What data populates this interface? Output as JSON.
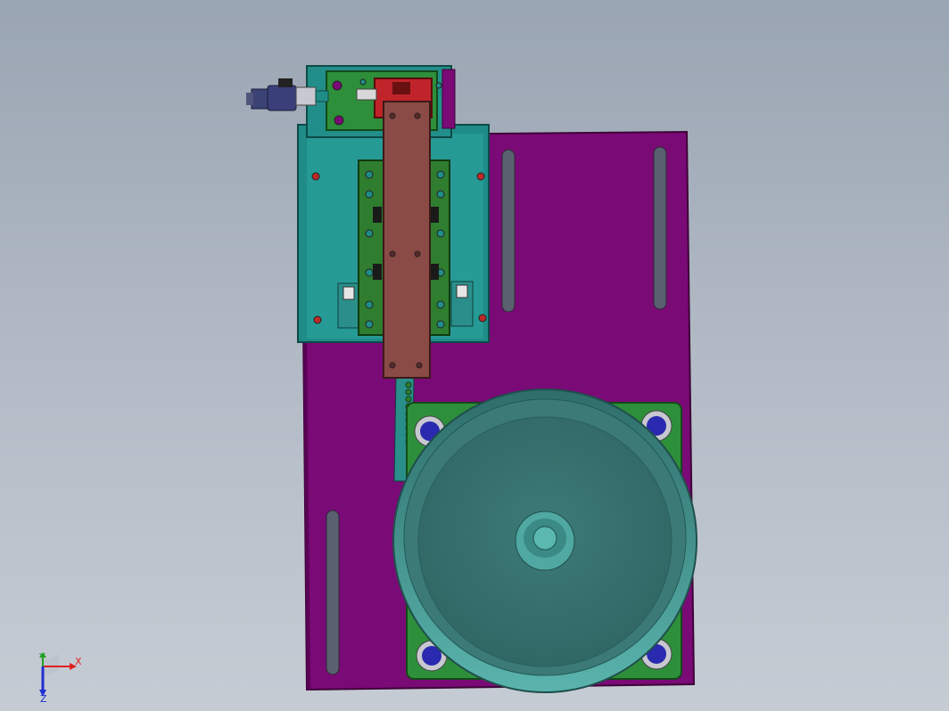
{
  "viewport": {
    "background_top": "#9aa5b3",
    "background_bottom": "#c6ccd4"
  },
  "colors": {
    "base_plate": "#7a0a76",
    "base_plate_edge": "#4e044b",
    "mount_plate": "#1e8a86",
    "rail_block": "#2f7d2f",
    "slider_bar": "#8a4a46",
    "clamp_block": "#c0242a",
    "bowl": "#3f8f8a",
    "bowl_inner": "#3a7472",
    "bumper": "#2a2ab0",
    "cylinder": "#3a3f7a"
  },
  "triad": {
    "x_label": "X",
    "y_label": "Y",
    "z_label": "Z",
    "x_color": "#e02020",
    "y_color": "#20a020",
    "z_color": "#2030d0"
  }
}
